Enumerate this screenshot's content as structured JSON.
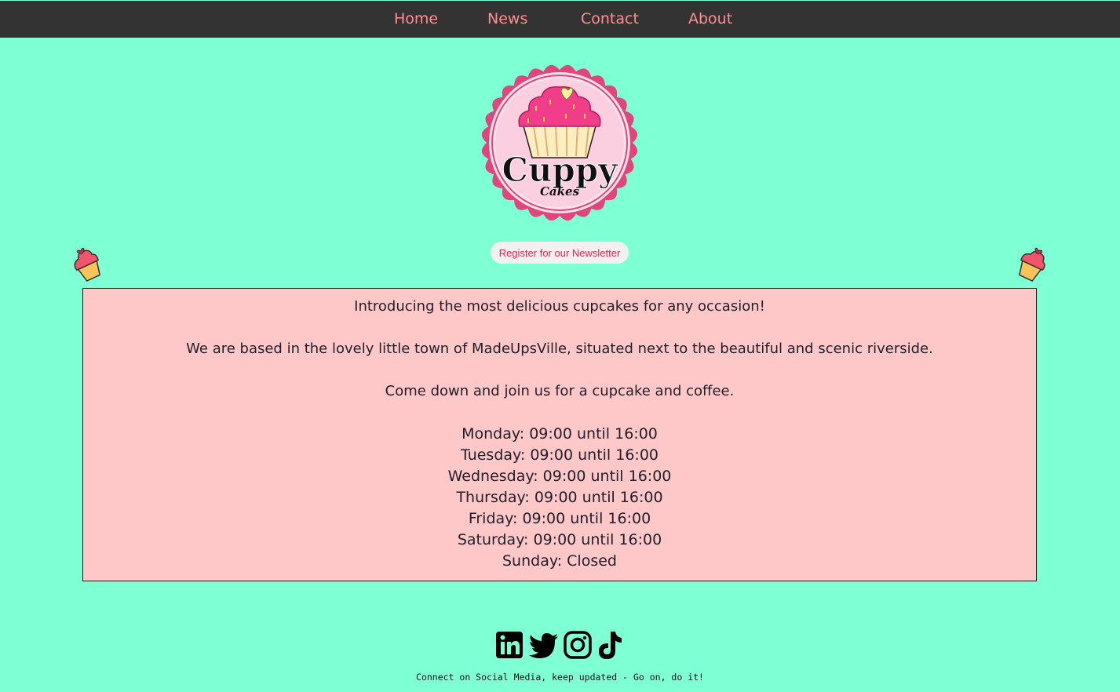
{
  "nav": {
    "items": [
      {
        "label": "Home"
      },
      {
        "label": "News"
      },
      {
        "label": "Contact"
      },
      {
        "label": "About"
      }
    ]
  },
  "logo": {
    "brand": "Cuppy",
    "sub": "Cakes"
  },
  "newsletter": {
    "label": "Register for our Newsletter"
  },
  "intro": {
    "line1": "Introducing the most delicious cupcakes for any occasion!",
    "line2": "We are based in the lovely little town of MadeUpsVille, situated next to the beautiful and scenic riverside.",
    "line3": "Come down and join us for a cupcake and coffee."
  },
  "hours": [
    "Monday: 09:00 until 16:00",
    "Tuesday: 09:00 until 16:00",
    "Wednesday: 09:00 until 16:00",
    "Thursday: 09:00 until 16:00",
    "Friday: 09:00 until 16:00",
    "Saturday: 09:00 until 16:00",
    "Sunday: Closed"
  ],
  "social": {
    "icons": [
      "linkedin-icon",
      "twitter-icon",
      "instagram-icon",
      "tiktok-icon"
    ]
  },
  "footer": {
    "text": "Connect on Social Media, keep updated - Go on, do it!"
  },
  "colors": {
    "background": "#7fffd4",
    "nav_bg": "#333333",
    "nav_link": "#ff8f8f",
    "box_bg": "#ffc8c8",
    "button_text": "#e0244e"
  }
}
